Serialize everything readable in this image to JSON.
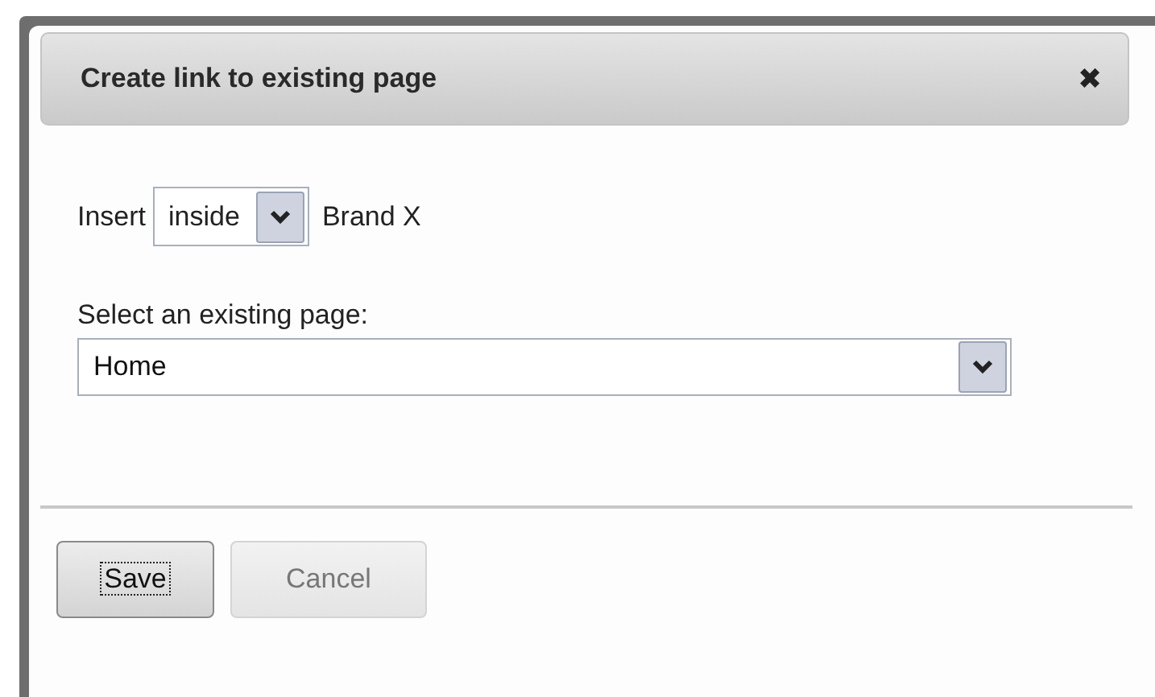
{
  "dialog": {
    "title": "Create link to existing page",
    "close": "✖"
  },
  "insert": {
    "label": "Insert",
    "value": "inside",
    "after": "Brand X"
  },
  "page_select": {
    "label": "Select an existing page:",
    "value": "Home"
  },
  "buttons": [
    {
      "label": "Save",
      "focused": true,
      "disabled": false
    },
    {
      "label": "Cancel",
      "focused": false,
      "disabled": true
    }
  ]
}
